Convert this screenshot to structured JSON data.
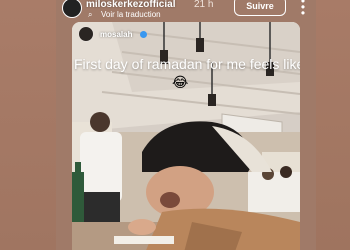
{
  "story": {
    "username": "miloskerkezofficial",
    "time": "21 h",
    "follow_label": "Suivre",
    "translate_label": "Voir la traduction"
  },
  "repost": {
    "username": "mosalah",
    "caption": "First day of ramadan for me  feels like",
    "emoji": "😂"
  },
  "colors": {
    "background": "#a77b67",
    "text": "#ffffff",
    "verified": "#3897f0"
  }
}
